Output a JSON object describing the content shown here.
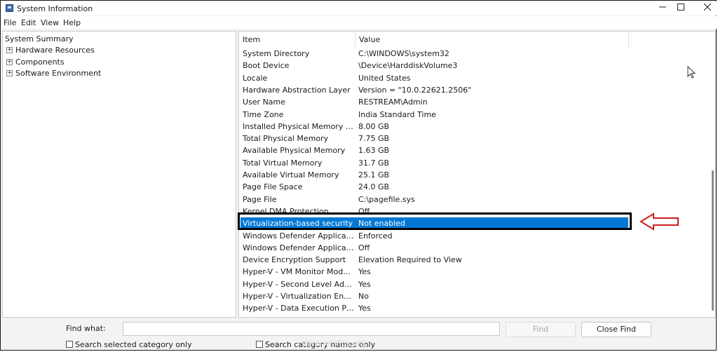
{
  "window": {
    "title": "System Information",
    "minimize_icon": "minimize-icon",
    "maximize_icon": "maximize-icon",
    "close_icon": "close-icon"
  },
  "menu": [
    "File",
    "Edit",
    "View",
    "Help"
  ],
  "tree": [
    {
      "label": "System Summary",
      "expandable": false
    },
    {
      "label": "Hardware Resources",
      "expandable": true
    },
    {
      "label": "Components",
      "expandable": true
    },
    {
      "label": "Software Environment",
      "expandable": true
    }
  ],
  "table": {
    "headers": [
      "Item",
      "Value"
    ],
    "rows": [
      {
        "item": "System Directory",
        "value": "C:\\WINDOWS\\system32"
      },
      {
        "item": "Boot Device",
        "value": "\\Device\\HarddiskVolume3"
      },
      {
        "item": "Locale",
        "value": "United States"
      },
      {
        "item": "Hardware Abstraction Layer",
        "value": "Version = \"10.0.22621.2506\""
      },
      {
        "item": "User Name",
        "value": "RESTREAM\\Admin"
      },
      {
        "item": "Time Zone",
        "value": "India Standard Time"
      },
      {
        "item": "Installed Physical Memory (RAM)",
        "value": "8.00 GB"
      },
      {
        "item": "Total Physical Memory",
        "value": "7.75 GB"
      },
      {
        "item": "Available Physical Memory",
        "value": "1.63 GB"
      },
      {
        "item": "Total Virtual Memory",
        "value": "31.7 GB"
      },
      {
        "item": "Available Virtual Memory",
        "value": "25.1 GB"
      },
      {
        "item": "Page File Space",
        "value": "24.0 GB"
      },
      {
        "item": "Page File",
        "value": "C:\\pagefile.sys"
      },
      {
        "item": "Kernel DMA Protection",
        "value": "Off"
      },
      {
        "item": "Virtualization-based security",
        "value": "Not enabled"
      },
      {
        "item": "Windows Defender Application...",
        "value": "Enforced"
      },
      {
        "item": "Windows Defender Application...",
        "value": "Off"
      },
      {
        "item": "Device Encryption Support",
        "value": "Elevation Required to View"
      },
      {
        "item": "Hyper-V - VM Monitor Mode E...",
        "value": "Yes"
      },
      {
        "item": "Hyper-V - Second Level Addres...",
        "value": "Yes"
      },
      {
        "item": "Hyper-V - Virtualization Enable...",
        "value": "No"
      },
      {
        "item": "Hyper-V - Data Execution Prote...",
        "value": "Yes"
      }
    ],
    "selected_index": 14
  },
  "find": {
    "label": "Find what:",
    "value": "",
    "find_button": "Find",
    "close_button": "Close Find",
    "check_selected": "Search selected category only",
    "check_names": "Search category names only"
  },
  "watermark": "www.wintips.org",
  "colors": {
    "selection": "#0078d4",
    "annotation_arrow": "#cc1f1f"
  }
}
